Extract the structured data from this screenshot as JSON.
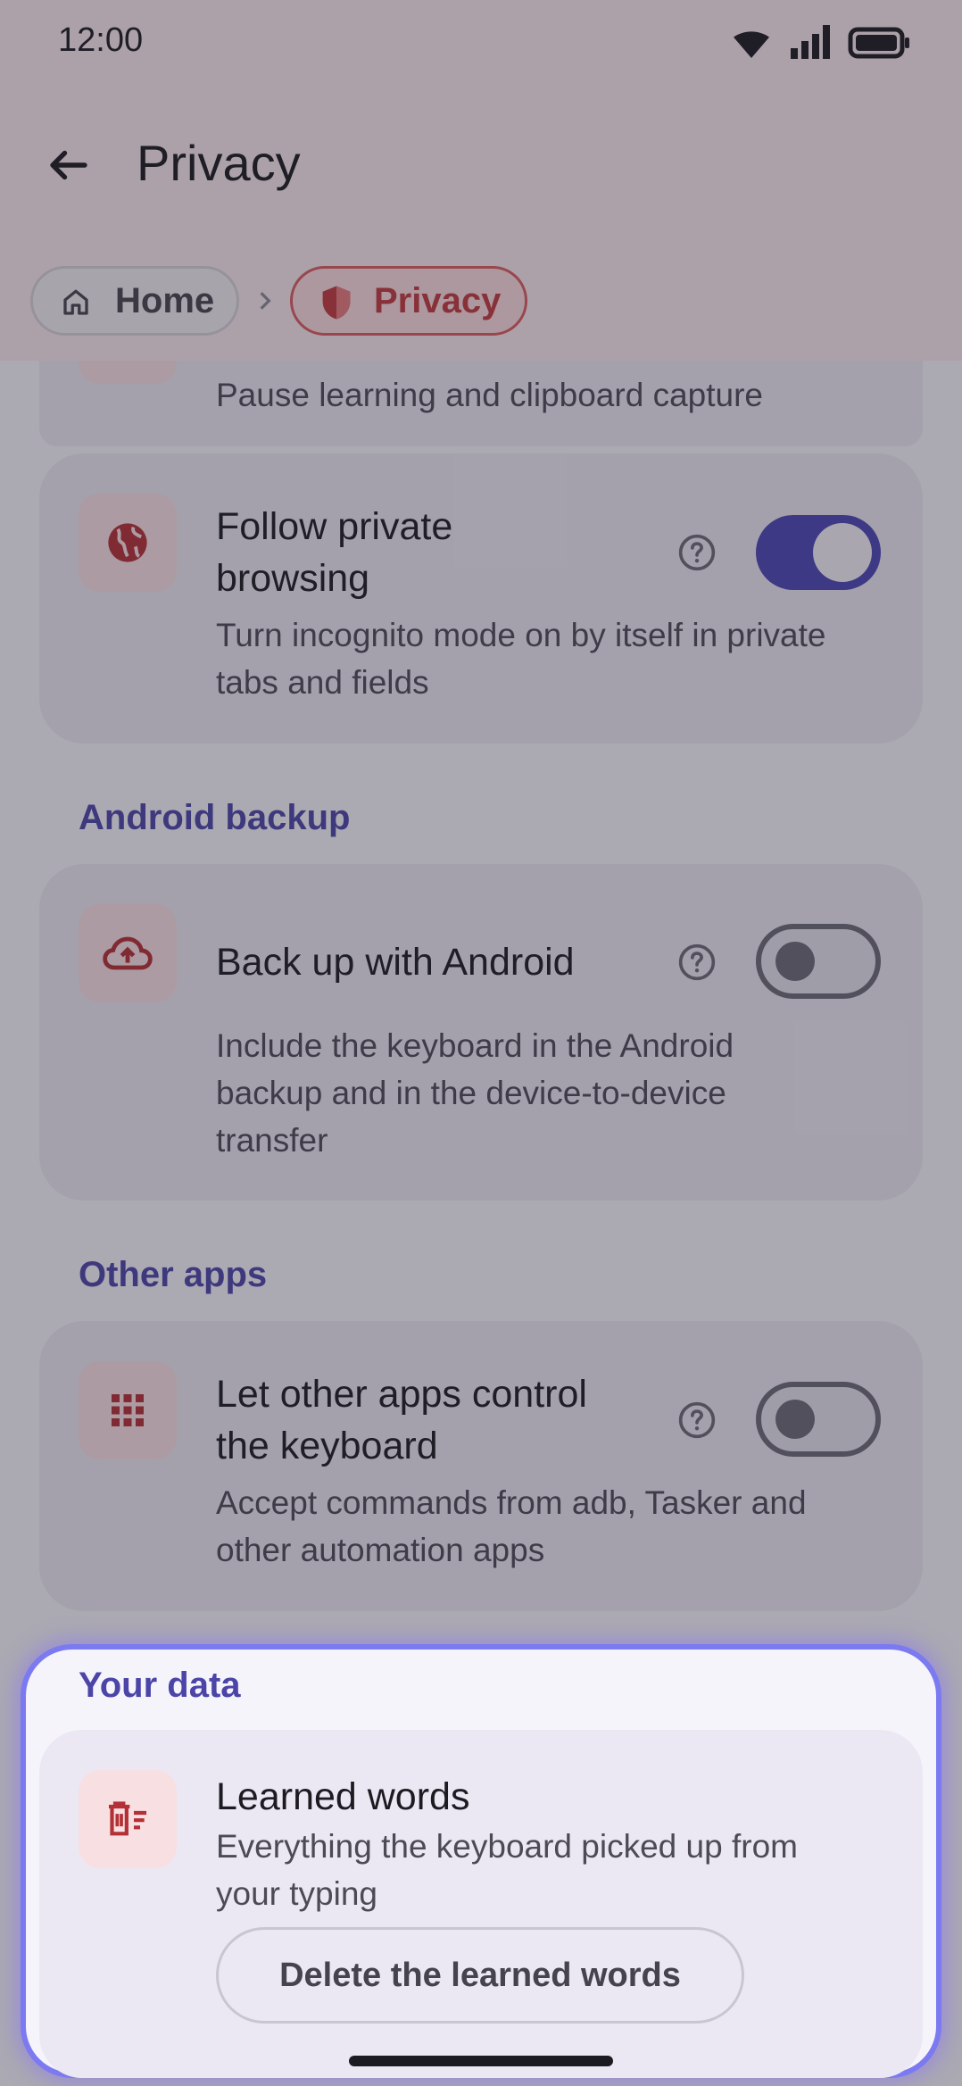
{
  "status_bar": {
    "time": "12:00"
  },
  "header": {
    "title": "Privacy"
  },
  "breadcrumb": {
    "home": "Home",
    "current": "Privacy"
  },
  "items": {
    "incognito": {
      "description": "Pause learning and clipboard capture"
    },
    "private_browsing": {
      "title_line1": "Follow private",
      "title_line2": "browsing",
      "desc_line1": "Turn incognito mode on by itself in private",
      "desc_line2": "tabs and fields",
      "enabled": true
    },
    "backup": {
      "section": "Android backup",
      "title": "Back up with Android",
      "desc_line1": "Include the keyboard in the Android",
      "desc_line2": "backup and in the device-to-device",
      "desc_line3": "transfer",
      "enabled": false
    },
    "other_apps": {
      "section": "Other apps",
      "title_line1": "Let other apps control",
      "title_line2": "the keyboard",
      "desc_line1": "Accept commands from adb, Tasker and",
      "desc_line2": "other automation apps",
      "enabled": false
    },
    "your_data": {
      "section": "Your data",
      "title": "Learned words",
      "desc_line1": "Everything the keyboard picked up from",
      "desc_line2": "your typing",
      "button": "Delete the learned words"
    }
  },
  "colors": {
    "accent": "#4a46b3",
    "brand_red": "#c0393e",
    "highlight": "#7b7af0"
  }
}
